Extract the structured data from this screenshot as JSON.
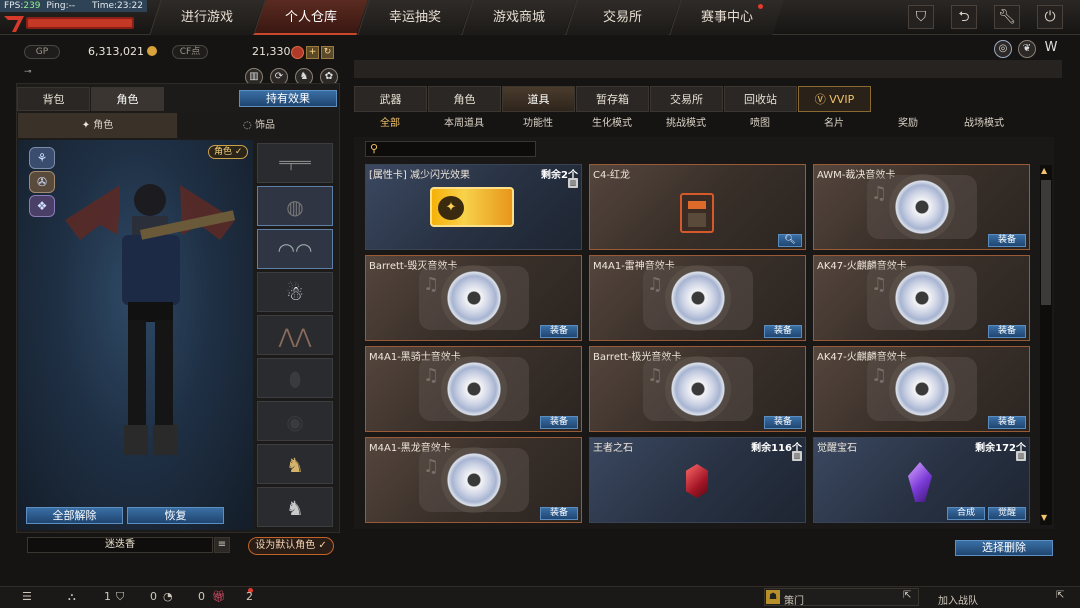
{
  "debug": {
    "fps_label": "FPS:",
    "fps": "239",
    "ping_label": "Ping:",
    "ping": "--",
    "time_label": "Time:",
    "time": "23:22"
  },
  "nav": {
    "tabs": [
      {
        "label": "进行游戏"
      },
      {
        "label": "个人仓库"
      },
      {
        "label": "幸运抽奖"
      },
      {
        "label": "游戏商城"
      },
      {
        "label": "交易所"
      },
      {
        "label": "赛事中心"
      }
    ],
    "icons": [
      "shield-icon",
      "back-icon",
      "wrench-icon",
      "power-icon"
    ]
  },
  "currency": {
    "gp_label": "GP",
    "gp_value": "6,313,021",
    "cf_label": "CF点",
    "cf_value": "21,330",
    "plus": "+"
  },
  "left": {
    "tabs": [
      {
        "label": "背包"
      },
      {
        "label": "角色"
      }
    ],
    "owned_effect": "持有效果",
    "subtabs": [
      {
        "label": "角色"
      },
      {
        "label": "饰品"
      }
    ],
    "role_badge": "角色 ✓",
    "unequip_all": "全部解除",
    "restore": "恢复",
    "char_name": "迷迭香",
    "set_default": "设为默认角色 ✓"
  },
  "right": {
    "tabs": [
      {
        "label": "武器"
      },
      {
        "label": "角色"
      },
      {
        "label": "道具"
      },
      {
        "label": "暂存箱"
      },
      {
        "label": "交易所"
      },
      {
        "label": "回收站"
      },
      {
        "label": "VVIP"
      }
    ],
    "categories": [
      {
        "label": "全部"
      },
      {
        "label": "本周道具"
      },
      {
        "label": "功能性"
      },
      {
        "label": "生化模式"
      },
      {
        "label": "挑战模式"
      },
      {
        "label": "喷图"
      },
      {
        "label": "名片"
      },
      {
        "label": "奖励"
      },
      {
        "label": "战场模式"
      }
    ],
    "select_delete": "选择删除"
  },
  "cards": [
    {
      "name": "[属性卡] 减少闪光效果",
      "count": "剩余2个",
      "type": "ticket",
      "button": ""
    },
    {
      "name": "C4-红龙",
      "count": "",
      "type": "c4",
      "button": ""
    },
    {
      "name": "AWM-裁决音效卡",
      "count": "",
      "type": "disc",
      "button": "装备"
    },
    {
      "name": "Barrett-毁灭音效卡",
      "count": "",
      "type": "disc",
      "button": "装备"
    },
    {
      "name": "M4A1-雷神音效卡",
      "count": "",
      "type": "disc",
      "button": "装备"
    },
    {
      "name": "AK47-火麒麟音效卡",
      "count": "",
      "type": "disc",
      "button": "装备"
    },
    {
      "name": "M4A1-黑骑士音效卡",
      "count": "",
      "type": "disc",
      "button": "装备"
    },
    {
      "name": "Barrett-极光音效卡",
      "count": "",
      "type": "disc",
      "button": "装备"
    },
    {
      "name": "AK47-火麒麟音效卡",
      "count": "",
      "type": "disc",
      "button": "装备"
    },
    {
      "name": "M4A1-黑龙音效卡",
      "count": "",
      "type": "disc",
      "button": "装备"
    },
    {
      "name": "王者之石",
      "count": "剩余116个",
      "type": "gem-red",
      "button": ""
    },
    {
      "name": "觉醒宝石",
      "count": "剩余172个",
      "type": "gem-purple",
      "button": ""
    }
  ],
  "gem_buttons": {
    "combine": "合成",
    "awaken": "觉醒"
  },
  "bottom": {
    "count1": "1",
    "count2": "0",
    "count3": "0",
    "count4": "2",
    "clan": "策门",
    "join_team": "加入战队"
  },
  "colors": {
    "accent_red": "#c8482a",
    "accent_blue": "#3a6fa5",
    "gold": "#f1c36a"
  }
}
